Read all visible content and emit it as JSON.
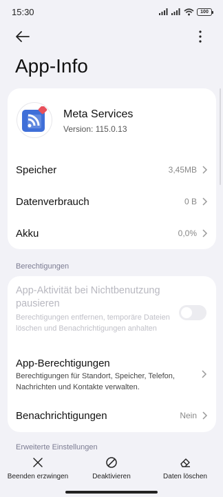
{
  "status_bar": {
    "time": "15:30",
    "battery": "100",
    "icons": [
      "signal-icon",
      "signal-icon",
      "wifi-icon",
      "battery-icon"
    ]
  },
  "top_bar": {
    "back_icon": "back-arrow-icon",
    "more_icon": "more-vertical-icon"
  },
  "page": {
    "title": "App-Info"
  },
  "app": {
    "name": "Meta Services",
    "version": "Version: 115.0.13",
    "icon": "meta-services-app-icon"
  },
  "info_rows": [
    {
      "label": "Speicher",
      "value": "3,45MB"
    },
    {
      "label": "Datenverbrauch",
      "value": "0 B"
    },
    {
      "label": "Akku",
      "value": "0,0%"
    }
  ],
  "permissions": {
    "section_title": "Berechtigungen",
    "pause_activity": {
      "title": "App-Aktivität bei Nichtbenutzung pausieren",
      "subtitle": "Berechtigungen entfernen, temporäre Dateien löschen und Benachrichtigungen anhalten",
      "enabled": false,
      "toggle_on": false
    },
    "app_permissions": {
      "title": "App-Berechtigungen",
      "subtitle": "Berechtigungen für Standort, Speicher, Telefon, Nachrichten und Kontakte verwalten."
    },
    "notifications": {
      "label": "Benachrichtigungen",
      "value": "Nein"
    }
  },
  "advanced": {
    "section_title": "Erweiterte Einstellungen"
  },
  "bottom_actions": [
    {
      "label": "Beenden erzwingen",
      "icon": "close-icon"
    },
    {
      "label": "Deaktivieren",
      "icon": "block-icon"
    },
    {
      "label": "Daten löschen",
      "icon": "eraser-icon"
    }
  ],
  "colors": {
    "background": "#f2f2f7",
    "card": "#ffffff",
    "section_text": "#7c7c92",
    "app_icon_blue": "#3f6fd8",
    "app_icon_badge": "#e8505b"
  }
}
